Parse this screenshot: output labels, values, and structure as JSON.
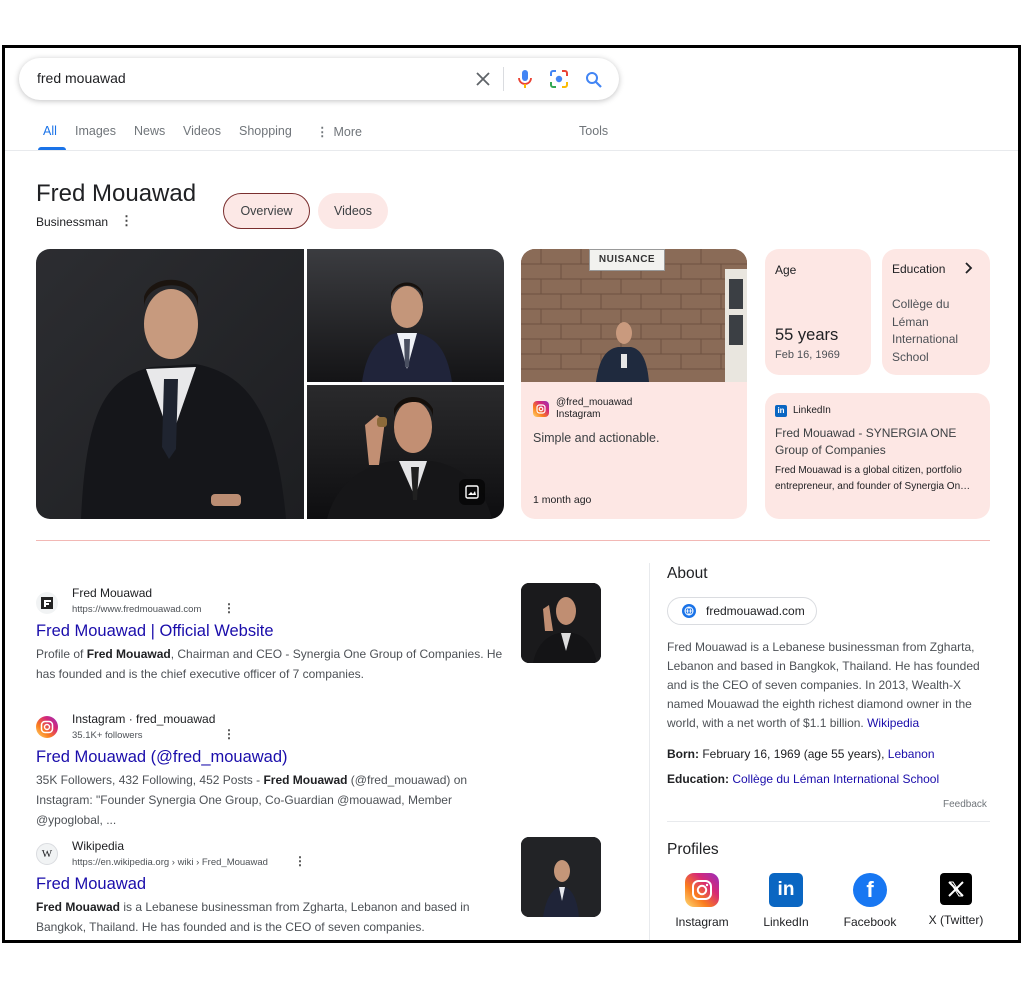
{
  "search": {
    "query": "fred mouawad"
  },
  "tabs": [
    "All",
    "Images",
    "News",
    "Videos",
    "Shopping",
    "More",
    "Tools"
  ],
  "knowledge_panel": {
    "name": "Fred Mouawad",
    "subtitle": "Businessman",
    "chips": [
      "Overview",
      "Videos"
    ],
    "sign_text": "NUISANCE",
    "instagram_card": {
      "handle": "@fred_mouawad",
      "source": "Instagram",
      "text": "Simple and actionable.",
      "time": "1 month ago"
    },
    "age_card": {
      "label": "Age",
      "value": "55 years",
      "date": "Feb 16, 1969"
    },
    "education_card": {
      "label": "Education",
      "value": "Collège du Léman International School"
    },
    "linkedin_card": {
      "source": "LinkedIn",
      "title": "Fred Mouawad - SYNERGIA ONE Group of Companies",
      "text": "Fred Mouawad is a global citizen, portfolio entrepreneur, and founder of Synergia On…"
    }
  },
  "results": [
    {
      "site": "Fred Mouawad",
      "url": "https://www.fredmouawad.com",
      "title": "Fred Mouawad | Official Website",
      "snippet_1": "Profile of ",
      "snippet_bold": "Fred Mouawad",
      "snippet_2": ", Chairman and CEO - Synergia One Group of Companies. He has founded and is the chief executive officer of 7 companies."
    },
    {
      "site": "Instagram · fred_mouawad",
      "url": "35.1K+ followers",
      "title": "Fred Mouawad (@fred_mouawad)",
      "snippet_1": "35K Followers, 432 Following, 452 Posts - ",
      "snippet_bold": "Fred Mouawad",
      "snippet_2": " (@fred_mouawad) on Instagram: \"Founder Synergia One Group, Co-Guardian @mouawad, Member @ypoglobal, ..."
    },
    {
      "site": "Wikipedia",
      "url": "https://en.wikipedia.org › wiki › Fred_Mouawad",
      "title": "Fred Mouawad",
      "snippet_1": "",
      "snippet_bold": "Fred Mouawad",
      "snippet_2": " is a Lebanese businessman from Zgharta, Lebanon and based in Bangkok, Thailand. He has founded and is the CEO of seven companies."
    }
  ],
  "about": {
    "heading": "About",
    "site_chip": "fredmouawad.com",
    "text": "Fred Mouawad is a Lebanese businessman from Zgharta, Lebanon and based in Bangkok, Thailand. He has founded and is the CEO of seven companies. In 2013, Wealth-X named Mouawad the eighth richest diamond owner in the world, with a net worth of $1.1 billion. ",
    "source_link": "Wikipedia",
    "born_label": "Born:",
    "born_value": " February 16, 1969 (age 55 years), ",
    "born_link": "Lebanon",
    "education_label": "Education:",
    "education_link": "Collège du Léman International School",
    "feedback": "Feedback"
  },
  "profiles": {
    "heading": "Profiles",
    "items": [
      "Instagram",
      "LinkedIn",
      "Facebook",
      "X (Twitter)"
    ]
  }
}
